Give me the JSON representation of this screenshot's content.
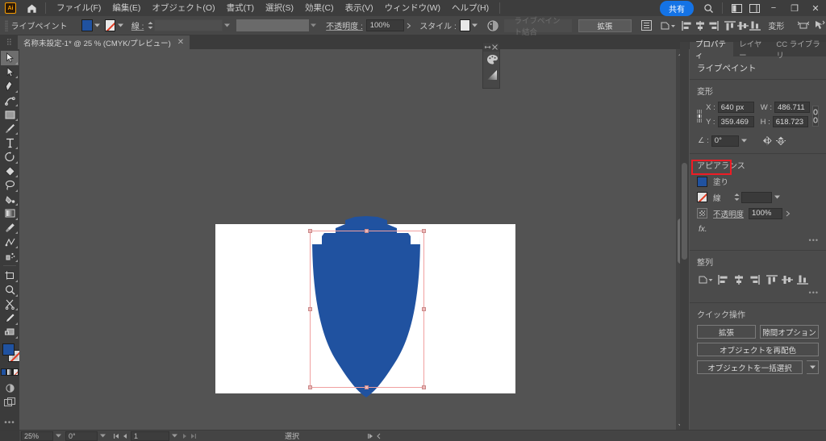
{
  "app": {
    "logo_text": "Ai",
    "home_icon": "home-icon"
  },
  "menubar": {
    "items": [
      {
        "label": "ファイル(F)"
      },
      {
        "label": "編集(E)"
      },
      {
        "label": "オブジェクト(O)"
      },
      {
        "label": "書式(T)"
      },
      {
        "label": "選択(S)"
      },
      {
        "label": "効果(C)"
      },
      {
        "label": "表示(V)"
      },
      {
        "label": "ウィンドウ(W)"
      },
      {
        "label": "ヘルプ(H)"
      }
    ],
    "share_label": "共有",
    "search_icon": "search-icon",
    "workspace_icon": "workspace-switcher-icon",
    "arrange_icon": "arrange-documents-icon",
    "minimize": "−",
    "maximize": "❐",
    "close": "✕"
  },
  "controlbar": {
    "mode_label": "ライブペイント",
    "fill_color": "#2052a0",
    "stroke_value": "なし",
    "stroke_label": "線 :",
    "stroke_weight": "",
    "stroke_profile": "",
    "opacity_label": "不透明度 :",
    "opacity_value": "100%",
    "style_label": "スタイル :",
    "style_color": "#e8e8e8",
    "merge_label": "ライブペイント結合",
    "expand_label": "拡張",
    "transform_label": "変形",
    "icons": [
      "document-setup-icon",
      "shape-options-icon",
      "align-left-icon",
      "align-center-horizontal-icon",
      "align-right-icon",
      "align-top-icon",
      "align-center-vertical-icon",
      "align-bottom-icon",
      "transform-icon",
      "isolate-selection-icon",
      "select-similar-icon"
    ]
  },
  "doctab": {
    "title": "名称未設定-1* @ 25 % (CMYK/プレビュー)",
    "close": "✕"
  },
  "toolbar": {
    "tools": [
      {
        "name": "selection-tool",
        "active": true
      },
      {
        "name": "direct-selection-tool",
        "active": false
      },
      {
        "name": "pen-tool",
        "active": false
      },
      {
        "name": "curvature-tool",
        "active": false
      },
      {
        "name": "rectangle-tool",
        "active": false
      },
      {
        "name": "paintbrush-tool",
        "active": false
      },
      {
        "name": "type-tool",
        "active": false
      },
      {
        "name": "rotate-tool",
        "active": false
      },
      {
        "name": "shaper-tool",
        "active": false
      },
      {
        "name": "lasso-tool",
        "active": false
      },
      {
        "name": "live-paint-bucket-tool",
        "active": false
      },
      {
        "name": "gradient-tool",
        "active": false
      },
      {
        "name": "eyedropper-tool",
        "active": false
      },
      {
        "name": "blend-tool",
        "active": false
      },
      {
        "name": "symbol-sprayer-tool",
        "active": false
      },
      {
        "name": "artboard-tool",
        "active": false
      },
      {
        "name": "zoom-tool",
        "active": false
      },
      {
        "name": "scissors-tool",
        "active": false
      },
      {
        "name": "pencil-tool",
        "active": false
      },
      {
        "name": "free-transform-tool",
        "active": false
      }
    ],
    "fill_color": "#2052a0",
    "stroke_color": "none",
    "more_tools": "•••"
  },
  "canvas": {
    "artboard_bg": "#ffffff",
    "shield_color": "#2052a0",
    "selection_color": "#f0a0a0",
    "shape_name": "shield-shape"
  },
  "mini_panel": {
    "collapse_icon": "collapse-icon",
    "close_icon": "close-icon",
    "tools": [
      "color-palette-icon",
      "gradient-icon"
    ]
  },
  "properties": {
    "tabs": [
      {
        "label": "プロパティ",
        "active": true
      },
      {
        "label": "レイヤー",
        "active": false
      },
      {
        "label": "CC ライブラリ",
        "active": false
      }
    ],
    "title": "ライブペイント",
    "transform": {
      "section_label": "変形",
      "x_label": "X :",
      "x_value": "640 px",
      "y_label": "Y :",
      "y_value": "359.469",
      "w_label": "W :",
      "w_value": "486.711",
      "h_label": "H :",
      "h_value": "618.723",
      "angle_label": "∠ :",
      "angle_value": "0°",
      "flip_h_icon": "flip-horizontal-icon",
      "flip_v_icon": "flip-vertical-icon",
      "link_icon": "link-ratio-icon",
      "reference_point": "center"
    },
    "appearance": {
      "section_label": "アピアランス",
      "fill_label": "塗り",
      "fill_color": "#2052a0",
      "stroke_label": "線",
      "stroke_color": "none",
      "stroke_weight": "",
      "opacity_label": "不透明度",
      "opacity_value": "100%",
      "fx_label": "fx.",
      "more": "•••",
      "highlight_color": "#ee1c25"
    },
    "align": {
      "section_label": "整列",
      "icons": [
        "align-to-selection-icon",
        "align-left-icon",
        "align-center-horizontal-icon",
        "align-right-icon",
        "align-top-icon",
        "align-center-vertical-icon",
        "align-bottom-icon"
      ],
      "more": "•••"
    },
    "quick_actions": {
      "section_label": "クイック操作",
      "buttons": [
        {
          "label": "拡張"
        },
        {
          "label": "隙間オプション"
        },
        {
          "label": "オブジェクトを再配色"
        },
        {
          "label": "オブジェクトを一括選択"
        }
      ]
    }
  },
  "statusbar": {
    "zoom_value": "25%",
    "angle_value": "0°",
    "artboard_value": "1",
    "tool_text": "選択",
    "first_icon": "first-artboard-icon",
    "prev_icon": "prev-artboard-icon",
    "next_icon": "next-artboard-icon",
    "last_icon": "last-artboard-icon"
  }
}
